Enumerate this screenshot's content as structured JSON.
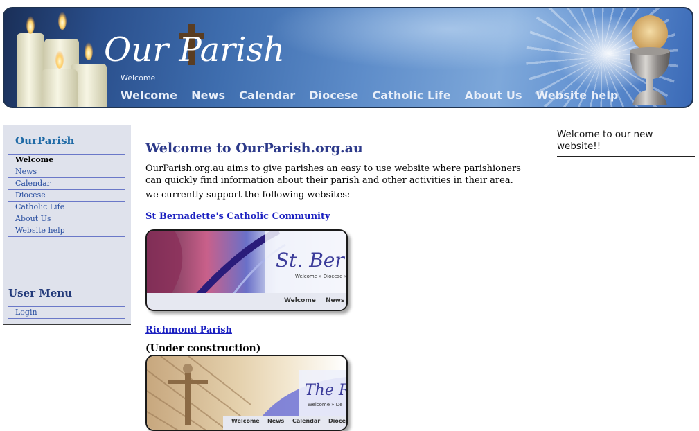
{
  "header": {
    "logo_text": "Our Parish",
    "breadcrumb": "Welcome",
    "nav": [
      "Welcome",
      "News",
      "Calendar",
      "Diocese",
      "Catholic Life",
      "About Us",
      "Website help"
    ]
  },
  "sidebar": {
    "title": "OurParish",
    "items": [
      {
        "label": "Welcome",
        "active": true
      },
      {
        "label": "News"
      },
      {
        "label": "Calendar"
      },
      {
        "label": "Diocese"
      },
      {
        "label": "Catholic Life"
      },
      {
        "label": "About Us"
      },
      {
        "label": "Website help"
      }
    ],
    "user_menu_title": "User Menu",
    "user_menu_items": [
      {
        "label": "Login"
      }
    ]
  },
  "main": {
    "heading": "Welcome to OurParish.org.au",
    "intro": "OurParish.org.au aims to give parishes an easy to use website where parishioners can quickly find information about their parish and other activities in their area.",
    "support_text": "we currently support the following websites:",
    "sites": [
      {
        "name": "St Bernadette's Catholic Community",
        "thumb_title": "St. Ber",
        "thumb_crumb": "Welcome » Diocese »",
        "thumb_nav": [
          "Welcome",
          "News"
        ]
      },
      {
        "name": "Richmond Parish",
        "note": "(Under construction)",
        "thumb_title": "The R",
        "thumb_crumb": "Welcome » De",
        "thumb_nav": [
          "Welcome",
          "News",
          "Calendar",
          "Dioce"
        ]
      }
    ]
  },
  "right": {
    "message": "Welcome to our new website!!"
  },
  "colors": {
    "header_blue": "#3e6dae",
    "sidebar_bg": "#dfe2ec",
    "heading_blue": "#2d3a8a",
    "link_blue": "#1a1fc0"
  }
}
